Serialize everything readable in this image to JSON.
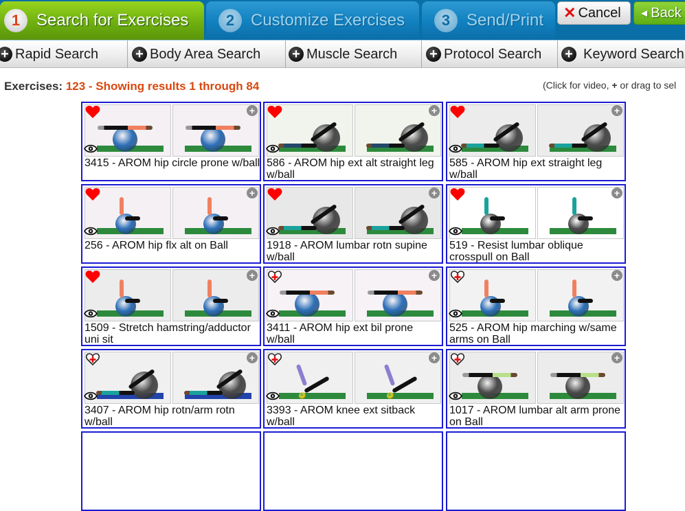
{
  "wizard": {
    "steps": [
      {
        "num": "1",
        "label": "Search for Exercises",
        "active": true
      },
      {
        "num": "2",
        "label": "Customize Exercises",
        "active": false
      },
      {
        "num": "3",
        "label": "Send/Print",
        "active": false
      }
    ],
    "cancel_label": "Cancel",
    "back_label": "Back"
  },
  "subnav": {
    "tabs": [
      {
        "label": "Rapid Search"
      },
      {
        "label": "Body Area Search"
      },
      {
        "label": "Muscle Search"
      },
      {
        "label": "Protocol Search"
      },
      {
        "label": "Keyword Search"
      }
    ]
  },
  "summary": {
    "prefix": "Exercises:",
    "count_text": "123 - Showing results 1 through 84",
    "total": 123,
    "range_start": 1,
    "range_end": 84
  },
  "hint": {
    "before": "(Click for video, ",
    "bold": "+",
    "after": " or drag to sel"
  },
  "colors": {
    "active_step": "#6fb010",
    "inactive_step": "#1282c1",
    "count_text": "#d9480f",
    "card_border": "#1a1ad4",
    "favorite": "#ff0000"
  },
  "exercises": [
    {
      "title": "3415 - AROM hip circle prone w/ball",
      "favorite": true,
      "scene": "prone-blue",
      "bg": "#f4f0f4"
    },
    {
      "title": "586 - AROM hip ext alt straight leg w/ball",
      "favorite": true,
      "scene": "supine-gray",
      "bg": "#f0f4ec"
    },
    {
      "title": "585 - AROM hip ext straight leg w/ball",
      "favorite": true,
      "scene": "supine-gray",
      "bg": "#ececec"
    },
    {
      "title": "256 - AROM hip flx alt on Ball",
      "favorite": true,
      "scene": "sit-blue",
      "bg": "#f4f0f4"
    },
    {
      "title": "1918 - AROM lumbar rotn supine w/ball",
      "favorite": true,
      "scene": "supine-gray",
      "bg": "#e8e8e8"
    },
    {
      "title": "519 - Resist lumbar oblique crosspull on Ball",
      "favorite": true,
      "scene": "sit-gray",
      "bg": "#ffffff"
    },
    {
      "title": "1509 - Stretch hamstring/adductor uni sit",
      "favorite": true,
      "scene": "sit-blue-mat",
      "bg": "#ececec"
    },
    {
      "title": "3411 - AROM hip ext bil prone w/ball",
      "favorite": false,
      "scene": "prone-blue",
      "bg": "#f6f2f6"
    },
    {
      "title": "525 - AROM hip marching w/same arms on Ball",
      "favorite": false,
      "scene": "sit-blue",
      "bg": "#f2f2f2"
    },
    {
      "title": "3407 - AROM hip rotn/arm rotn w/ball",
      "favorite": false,
      "scene": "supine-gray-bluemat",
      "bg": "#f0f0f0"
    },
    {
      "title": "3393 - AROM knee ext sitback w/ball",
      "favorite": false,
      "scene": "sitback",
      "bg": "#f0f0f0"
    },
    {
      "title": "1017 - AROM lumbar alt arm prone on Ball",
      "favorite": false,
      "scene": "prone-gray",
      "bg": "#ececec"
    }
  ],
  "icons": {
    "favorite_on": "heart-filled-icon",
    "favorite_off": "heart-plus-icon",
    "view": "eye-icon",
    "add": "plus-circle-icon",
    "cancel": "x-icon",
    "back": "triangle-left-icon"
  }
}
